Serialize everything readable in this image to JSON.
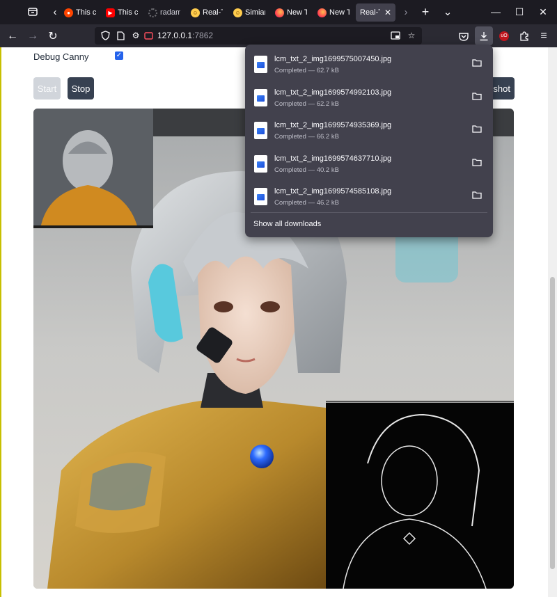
{
  "tabs": [
    {
      "label": "This c",
      "favicon": "reddit-icon",
      "color": "#ff4500"
    },
    {
      "label": "This c",
      "favicon": "youtube-icon",
      "color": "#ff0000"
    },
    {
      "label": "radam",
      "favicon": "github-icon",
      "color": "#6e6e73"
    },
    {
      "label": "Real-T",
      "favicon": "huggingface-icon",
      "color": "#ffcc4d"
    },
    {
      "label": "Simian",
      "favicon": "huggingface-icon",
      "color": "#ffcc4d"
    },
    {
      "label": "New T",
      "favicon": "firefox-icon",
      "color": "#ff7139"
    },
    {
      "label": "New T",
      "favicon": "firefox-icon",
      "color": "#ff7139"
    },
    {
      "label": "Real-Ti",
      "favicon": "none",
      "color": "#42414d",
      "active": true
    }
  ],
  "address": {
    "host": "127.0.0.1",
    "port": ":7862"
  },
  "page": {
    "debug_label": "Debug Canny",
    "debug_checked": true,
    "start_label": "Start",
    "stop_label": "Stop",
    "screenshot_label": "shot"
  },
  "downloads": {
    "items": [
      {
        "name": "lcm_txt_2_img1699575007450.jpg",
        "status": "Completed — 62.7 kB"
      },
      {
        "name": "lcm_txt_2_img1699574992103.jpg",
        "status": "Completed — 62.2 kB"
      },
      {
        "name": "lcm_txt_2_img1699574935369.jpg",
        "status": "Completed — 66.2 kB"
      },
      {
        "name": "lcm_txt_2_img1699574637710.jpg",
        "status": "Completed — 40.2 kB"
      },
      {
        "name": "lcm_txt_2_img1699574585108.jpg",
        "status": "Completed — 46.2 kB"
      }
    ],
    "show_all_label": "Show all downloads"
  },
  "colors": {
    "chrome_dark": "#1c1b22",
    "toolbar": "#2b2a33",
    "panel": "#42414d",
    "button_dark": "#374151",
    "button_disabled": "#d1d5db",
    "armor_gold": "#b8892c",
    "gem_blue": "#2d6bff"
  }
}
